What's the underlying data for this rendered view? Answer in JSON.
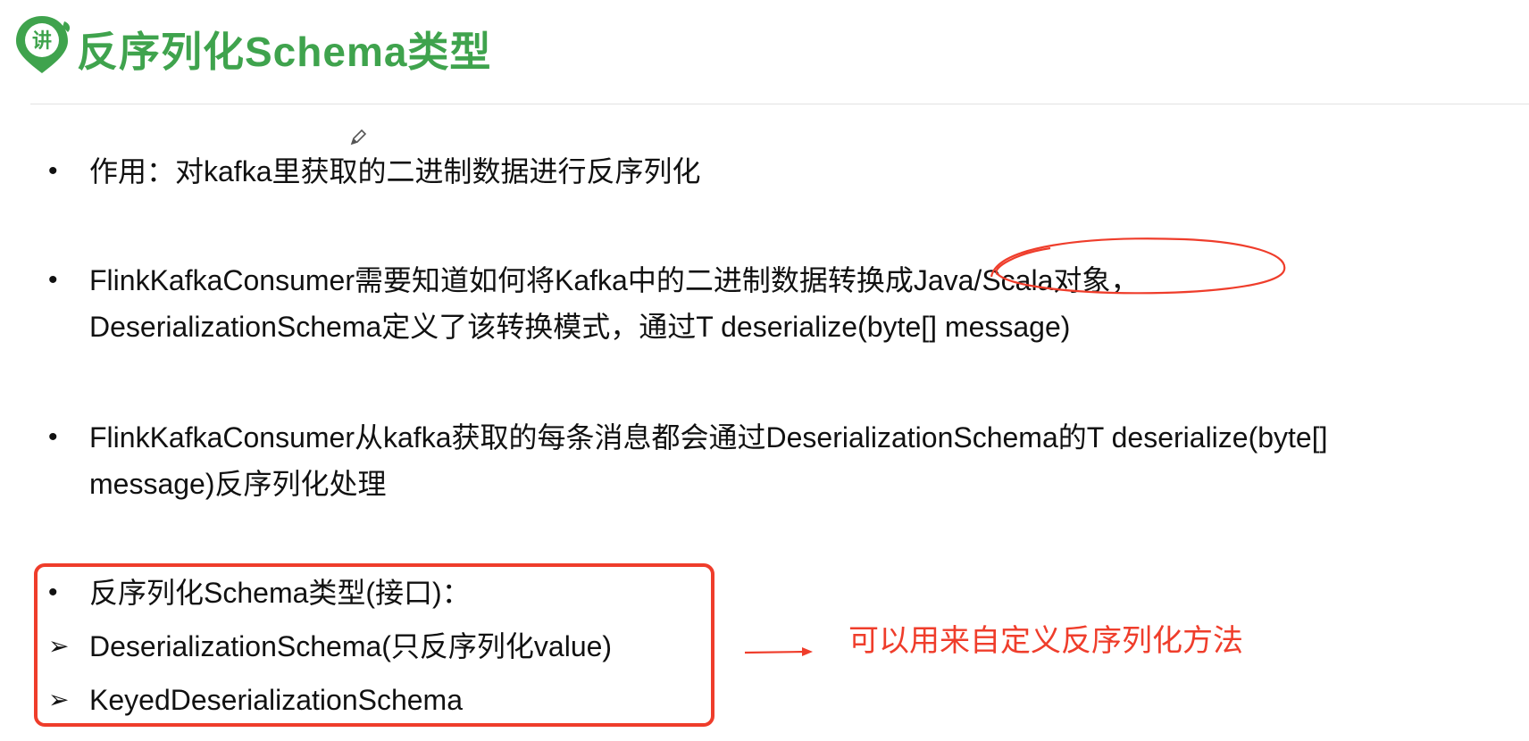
{
  "slide": {
    "title": "反序列化Schema类型",
    "logo_glyph": "讲",
    "colors": {
      "title_green": "#3fa34d",
      "accent_red": "#ef3d2b"
    },
    "icons": [
      "map-pin-logo-icon",
      "pencil-cursor-icon",
      "arrow-right-icon"
    ]
  },
  "bullets": [
    {
      "marker": "•",
      "lines": [
        "作用：对kafka里获取的二进制数据进行反序列化"
      ]
    },
    {
      "marker": "•",
      "lines": [
        "FlinkKafkaConsumer需要知道如何将Kafka中的二进制数据转换成Java/Scala对象，",
        "DeserializationSchema定义了该转换模式，通过T deserialize(byte[] message)"
      ]
    },
    {
      "marker": "•",
      "lines": [
        "FlinkKafkaConsumer从kafka获取的每条消息都会通过DeserializationSchema的T deserialize(byte[]",
        "message)反序列化处理"
      ]
    }
  ],
  "boxed": {
    "header_marker": "•",
    "header": "反序列化Schema类型(接口)：",
    "items": [
      {
        "marker": "➢",
        "text": "DeserializationSchema(只反序列化value)"
      },
      {
        "marker": "➢",
        "text": "KeyedDeserializationSchema"
      }
    ]
  },
  "annotation": {
    "note": "可以用来自定义反序列化方法"
  }
}
